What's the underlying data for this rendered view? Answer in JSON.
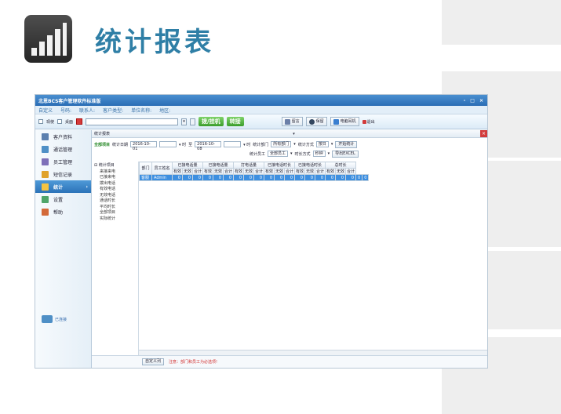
{
  "page": {
    "heading": "统计报表"
  },
  "window": {
    "title": "北恩BCS客户管理软件标准版",
    "controls": [
      "-",
      "□",
      "×"
    ],
    "info": [
      "自定义",
      "号码:",
      "联系人:",
      "客户类型:",
      "单位名称:",
      "地区:"
    ],
    "toolbar": {
      "check_label_1": "现使",
      "check_label_2": "桌面",
      "dial_label": "拨/挂机",
      "transfer_label": "转接",
      "buttons": [
        "留言",
        "保留",
        "电脑耳机",
        "退出"
      ]
    }
  },
  "sidebar": {
    "items": [
      {
        "label": "客户资料",
        "icon": "contacts-icon",
        "color": "#5b7fae",
        "active": false
      },
      {
        "label": "通话管理",
        "icon": "phone-icon",
        "color": "#4e8fc6",
        "active": false
      },
      {
        "label": "员工管理",
        "icon": "staff-icon",
        "color": "#7d6fb8",
        "active": false
      },
      {
        "label": "短信记录",
        "icon": "sms-icon",
        "color": "#e0a22a",
        "active": false
      },
      {
        "label": "统计",
        "icon": "stats-icon",
        "color": "#f6c443",
        "active": true
      },
      {
        "label": "设置",
        "icon": "settings-icon",
        "color": "#4ea56a",
        "active": false
      },
      {
        "label": "帮助",
        "icon": "help-icon",
        "color": "#d36a3a",
        "active": false
      }
    ],
    "connect_label": "已连接"
  },
  "panel": {
    "tab_label": "统计报表",
    "filters": {
      "all_items": "全部项目",
      "date_label": "统计日期",
      "date_from": "2016-10-01",
      "to_label": "至",
      "date_to": "2016-10-08",
      "dept_label": "统计部门",
      "dept_value": "所有部门",
      "method_label": "统计方式",
      "method_value": "按日",
      "start_button": "开始统计",
      "staff_label": "统计员工",
      "staff_value": "全部员工",
      "duration_label": "时长方式",
      "duration_value": "秒钟",
      "export_button": "导出EXCEL"
    },
    "tree": {
      "root": "统计项目",
      "children": [
        "来接来电",
        "已接来电",
        "拨出电话",
        "有效电话",
        "无效电话",
        "通话时长",
        "平均时长",
        "全部项目",
        "实际统计"
      ]
    },
    "table": {
      "headers_top": [
        "部门",
        "员工姓名",
        "已接电话量",
        "已接电话量",
        "打电话量",
        "已接电话时长",
        "已接电话时长",
        "总时长"
      ],
      "headers_sub": [
        "有效",
        "无效",
        "合计"
      ],
      "row": {
        "dept": "客服",
        "name": "Admin",
        "values": [
          "0",
          "0",
          "0",
          "0",
          "0",
          "0",
          "0",
          "0",
          "0",
          "0",
          "0",
          "0",
          "0",
          "0",
          "0",
          "0",
          "0",
          "0",
          "0",
          "0"
        ]
      }
    },
    "footer": {
      "custom_button": "自定义列",
      "warning": "注意：部门和员工为必选项!"
    }
  }
}
